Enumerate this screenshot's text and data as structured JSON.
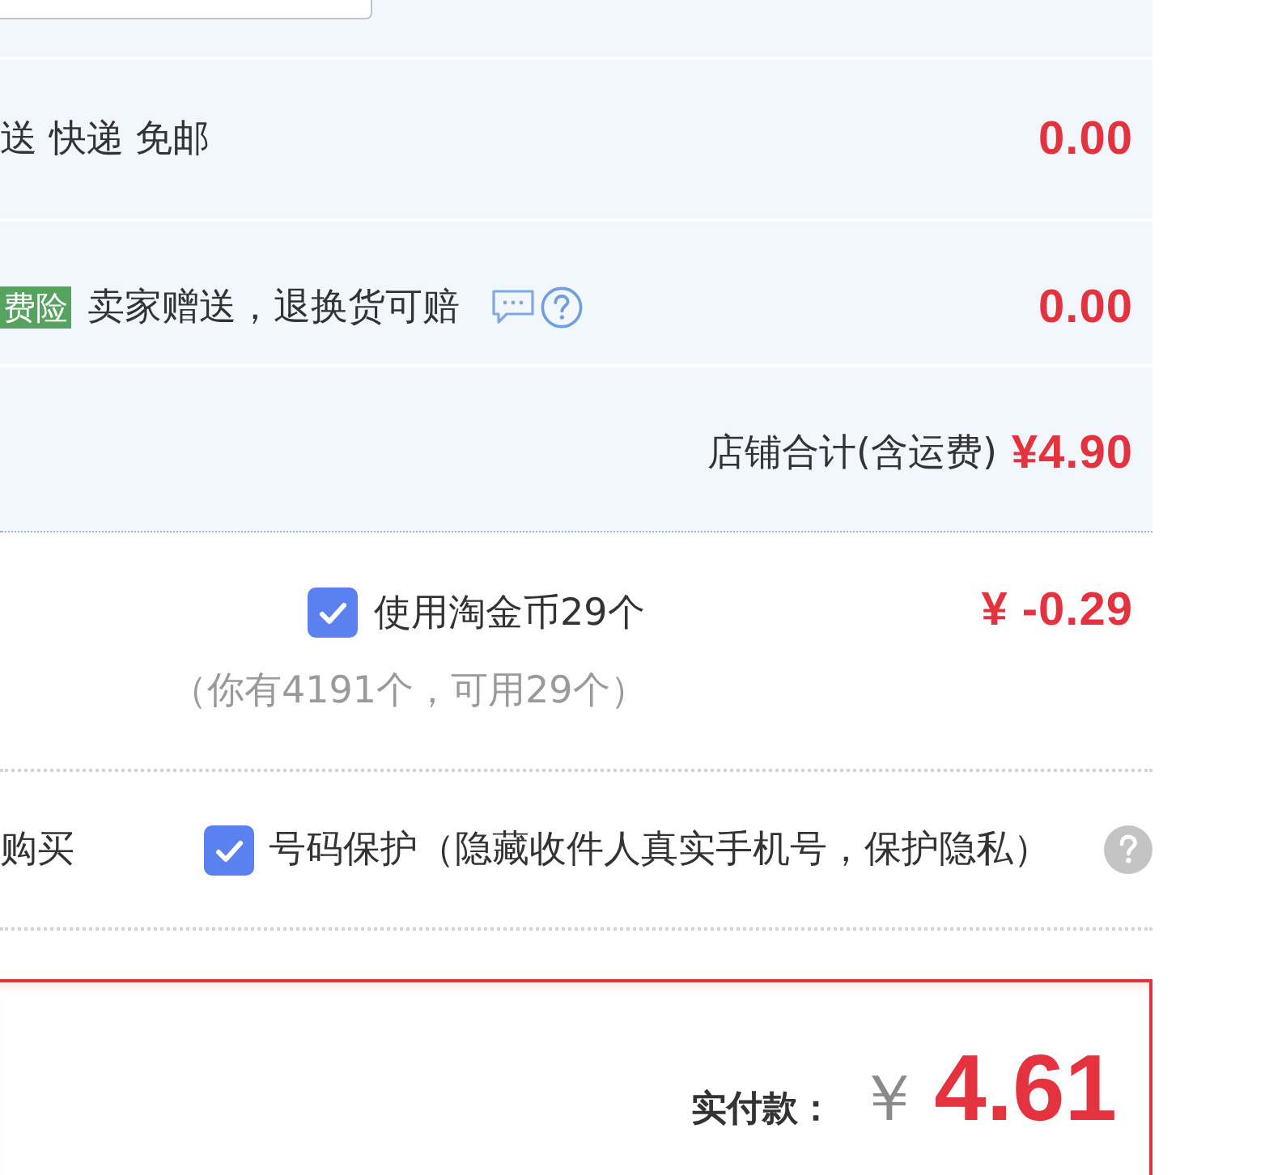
{
  "shipping": {
    "method": "送 快递 免邮",
    "amount": "0.00"
  },
  "insurance": {
    "badge": "费险",
    "description": "卖家赠送，退换货可赔",
    "amount": "0.00"
  },
  "store_total": {
    "label": "店铺合计(含运费)",
    "amount": "¥4.90"
  },
  "coins": {
    "checked": true,
    "label": "使用淘金币29个",
    "amount": "¥ -0.29",
    "note": "（你有4191个，可用29个）"
  },
  "privacy": {
    "left_label": "购买",
    "checked": true,
    "label": "号码保护（隐藏收件人真实手机号，保护隐私）"
  },
  "payment": {
    "label": "实付款：",
    "currency": "￥",
    "amount": "4.61"
  }
}
